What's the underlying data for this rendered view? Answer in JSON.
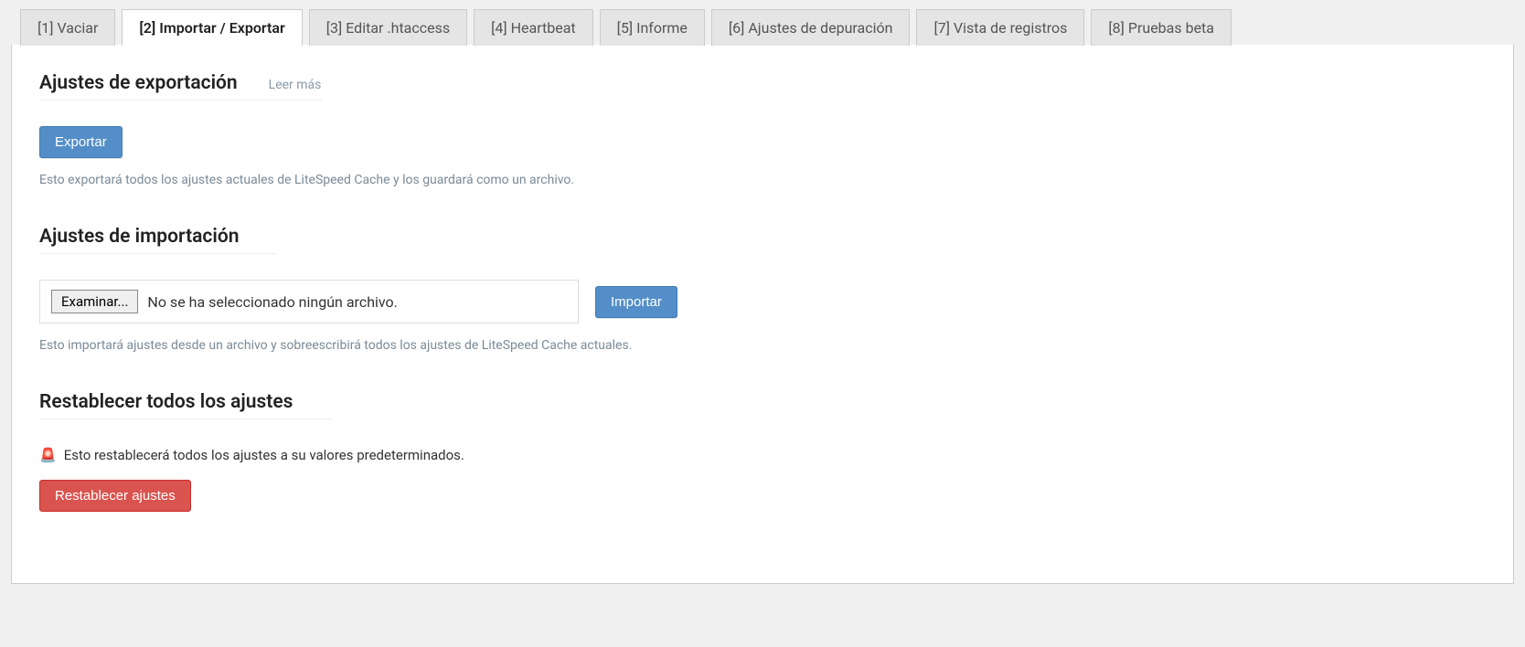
{
  "tabs": [
    {
      "label": "[1] Vaciar"
    },
    {
      "label": "[2] Importar / Exportar"
    },
    {
      "label": "[3] Editar .htaccess"
    },
    {
      "label": "[4] Heartbeat"
    },
    {
      "label": "[5] Informe"
    },
    {
      "label": "[6] Ajustes de depuración"
    },
    {
      "label": "[7] Vista de registros"
    },
    {
      "label": "[8] Pruebas beta"
    }
  ],
  "export": {
    "title": "Ajustes de exportación",
    "read_more": "Leer más",
    "button": "Exportar",
    "desc": "Esto exportará todos los ajustes actuales de LiteSpeed Cache y los guardará como un archivo."
  },
  "import": {
    "title": "Ajustes de importación",
    "browse": "Examinar...",
    "no_file": "No se ha seleccionado ningún archivo.",
    "button": "Importar",
    "desc": "Esto importará ajustes desde un archivo y sobreescribirá todos los ajustes de LiteSpeed Cache actuales."
  },
  "reset": {
    "title": "Restablecer todos los ajustes",
    "desc": "Esto restablecerá todos los ajustes a su valores predeterminados.",
    "button": "Restablecer ajustes"
  }
}
